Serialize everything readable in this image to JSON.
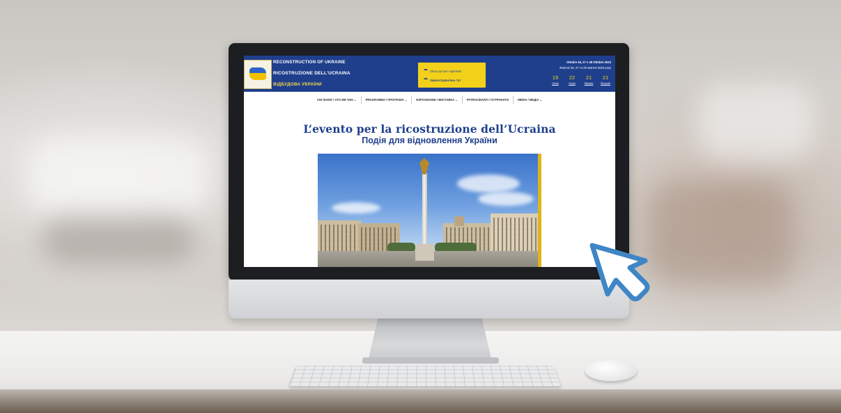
{
  "site": {
    "header": {
      "title_en": "RECONSTRUCTION OF UKRAINE",
      "title_it": "RICOSTRUZIONE DELL'UCRAINA",
      "title_ua": "ВІДБУДОВА УКРАЇНИ",
      "cta_primary": "Clicca qui per registrarti",
      "cta_secondary": "Зареєструватись тут",
      "date_it": "Ottobre 26, 27 e 28 Ottobre 2023",
      "date_ua": "Жовтня 26, 27 та 28 жовтня 2023 року",
      "countdown": [
        {
          "value": "19",
          "label": "Giorni"
        },
        {
          "value": "22",
          "label": "Hours"
        },
        {
          "value": "21",
          "label": "Minutes"
        },
        {
          "value": "21",
          "label": "Seconds"
        }
      ]
    },
    "nav": [
      "CHI SIAMO / ХТО МИ ТАКІ",
      "PROGRAMMA / ПРОГРАМА",
      "ESPOSIZIONE / ВИСТАВКА",
      "PATROCINANTI / ПАТРОНАТИ",
      "MEDIA / МЕДІА"
    ],
    "headline": "L’evento per la ricostruzione dell’Ucraina",
    "subheadline": "Подія для відновлення України",
    "hero_image": "Maidan Nezalezhnosti square, Kyiv"
  },
  "colors": {
    "brand_blue": "#1f3f8c",
    "brand_yellow": "#f3d11b",
    "cursor_blue": "#3f86c6"
  },
  "icons": [
    "wifi-icon",
    "chevron-down-icon",
    "cursor-icon"
  ]
}
